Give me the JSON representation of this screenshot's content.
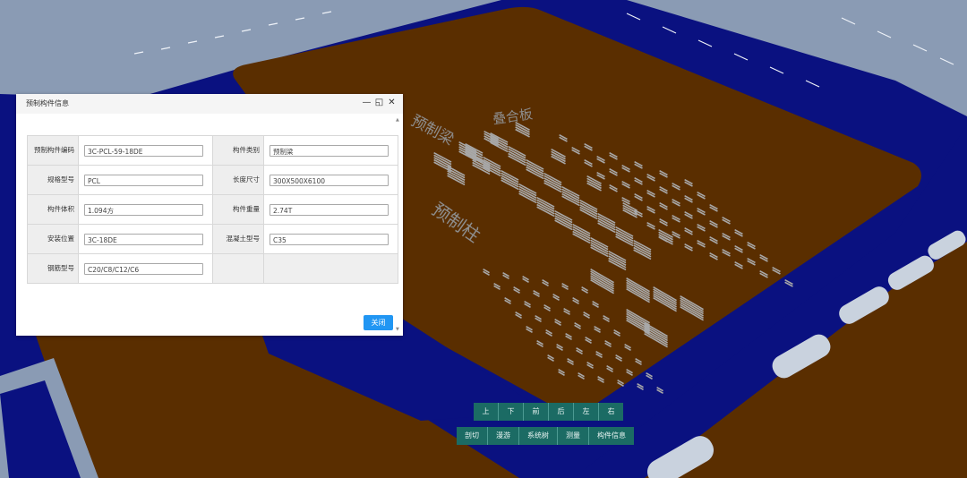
{
  "scene": {
    "labels": {
      "beams": "预制梁",
      "slabs": "叠合板",
      "columns": "预制柱"
    }
  },
  "dialog": {
    "title": "预制构件信息",
    "fields": [
      {
        "label": "预制构件编码",
        "value": "3C-PCL-59-18DE"
      },
      {
        "label": "构件类别",
        "value": "预制梁"
      },
      {
        "label": "规格型号",
        "value": "PCL"
      },
      {
        "label": "长度尺寸",
        "value": "300X500X6100"
      },
      {
        "label": "构件体积",
        "value": "1.094方"
      },
      {
        "label": "构件重量",
        "value": "2.74T"
      },
      {
        "label": "安装位置",
        "value": "3C-18DE"
      },
      {
        "label": "混凝土型号",
        "value": "C35"
      },
      {
        "label": "钢筋型号",
        "value": "C20/C8/C12/C6"
      }
    ],
    "close_button": "关闭",
    "minimize_icon": "minimize-icon",
    "maximize_icon": "maximize-icon",
    "close_icon": "close-icon"
  },
  "view_toolbar": [
    "上",
    "下",
    "前",
    "后",
    "左",
    "右"
  ],
  "tools_toolbar": [
    "剖切",
    "漫游",
    "系统树",
    "测量",
    "构件信息"
  ],
  "colors": {
    "ground": "#0a1180",
    "slab": "#5a2e00",
    "road": "#8a9bb4",
    "button_teal": "#1b6b64",
    "primary_blue": "#2196f3"
  }
}
